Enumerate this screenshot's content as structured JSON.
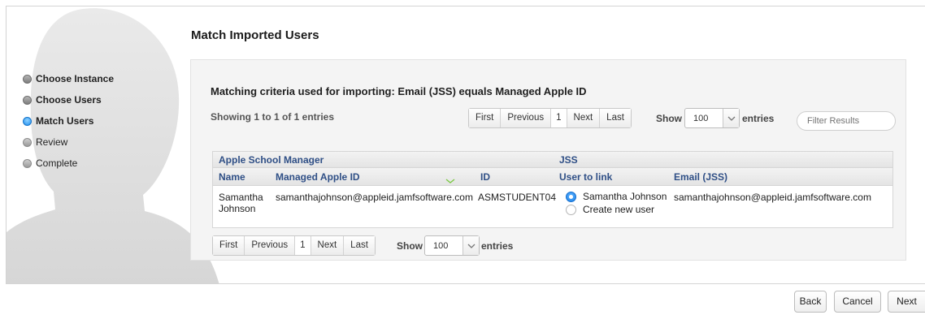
{
  "wizard": {
    "steps": [
      {
        "label": "Choose Instance",
        "state": "done"
      },
      {
        "label": "Choose Users",
        "state": "done"
      },
      {
        "label": "Match Users",
        "state": "active"
      },
      {
        "label": "Review",
        "state": "pending"
      },
      {
        "label": "Complete",
        "state": "pending"
      }
    ]
  },
  "page": {
    "title": "Match Imported Users",
    "criteria": "Matching criteria used for importing: Email (JSS) equals Managed Apple ID",
    "showing": "Showing 1 to 1 of 1 entries"
  },
  "pager": {
    "first": "First",
    "previous": "Previous",
    "page": "1",
    "next": "Next",
    "last": "Last"
  },
  "length": {
    "show_label": "Show",
    "value": "100",
    "entries_label": "entries"
  },
  "filter": {
    "placeholder": "Filter Results"
  },
  "table": {
    "groups": {
      "asm": "Apple School Manager",
      "jss": "JSS"
    },
    "columns": {
      "name": "Name",
      "managed_apple_id": "Managed Apple ID",
      "id": "ID",
      "user_to_link": "User to link",
      "email_jss": "Email (JSS)"
    },
    "rows": [
      {
        "name_line1": "Samantha",
        "name_line2": "Johnson",
        "managed_apple_id": "samanthajohnson@appleid.jamfsoftware.com",
        "id": "ASMSTUDENT04",
        "link_options": [
          "Samantha Johnson",
          "Create new user"
        ],
        "link_selected": "Samantha Johnson",
        "email_jss": "samanthajohnson@appleid.jamfsoftware.com"
      }
    ]
  },
  "footer": {
    "back": "Back",
    "cancel": "Cancel",
    "next": "Next"
  },
  "colors": {
    "header_text": "#2f4f86",
    "active_step": "#1e8ef0",
    "sort_chevron": "#7ac943"
  }
}
